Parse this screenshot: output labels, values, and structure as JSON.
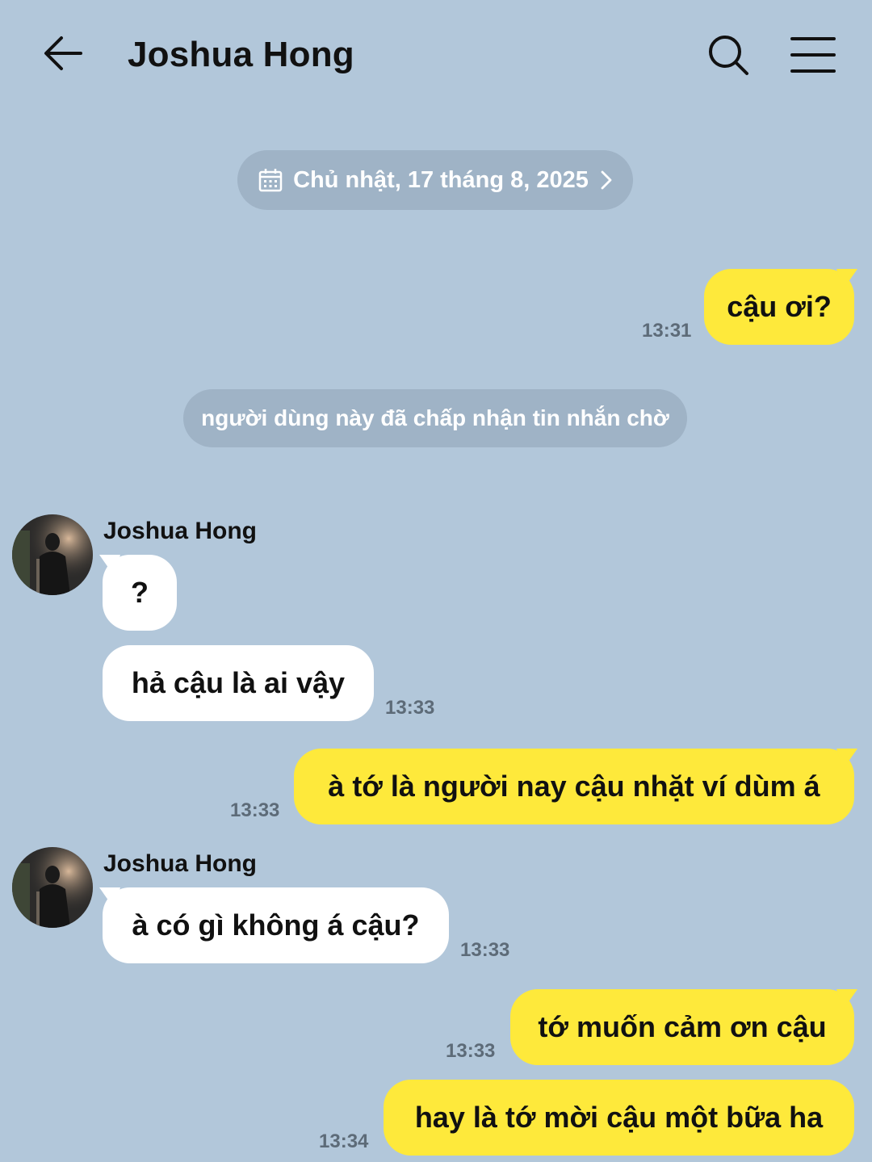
{
  "header": {
    "title": "Joshua Hong"
  },
  "date_divider": "Chủ nhật, 17 tháng 8, 2025",
  "system_notice": "người dùng này đã chấp nhận tin nhắn chờ",
  "messages": [
    {
      "text": "cậu ơi?",
      "time": "13:31"
    },
    {
      "sender": "Joshua Hong",
      "text": "?"
    },
    {
      "text": "hả cậu là ai vậy",
      "time": "13:33"
    },
    {
      "text": "à tớ là người nay cậu nhặt ví dùm á",
      "time": "13:33"
    },
    {
      "sender": "Joshua Hong",
      "text": "à có gì không á cậu?",
      "time": "13:33"
    },
    {
      "text": "tớ muốn cảm ơn cậu",
      "time": "13:33"
    },
    {
      "text": "hay là tớ mời cậu một bữa ha",
      "time": "13:34"
    }
  ],
  "colors": {
    "background": "#b2c7da",
    "outgoing_bubble": "#fee93b",
    "incoming_bubble": "#ffffff",
    "pill": "#9fb3c6"
  },
  "icons": {
    "back": "back-arrow-icon",
    "search": "search-icon",
    "menu": "hamburger-menu-icon",
    "calendar": "calendar-icon",
    "chevron": "chevron-right-icon"
  }
}
